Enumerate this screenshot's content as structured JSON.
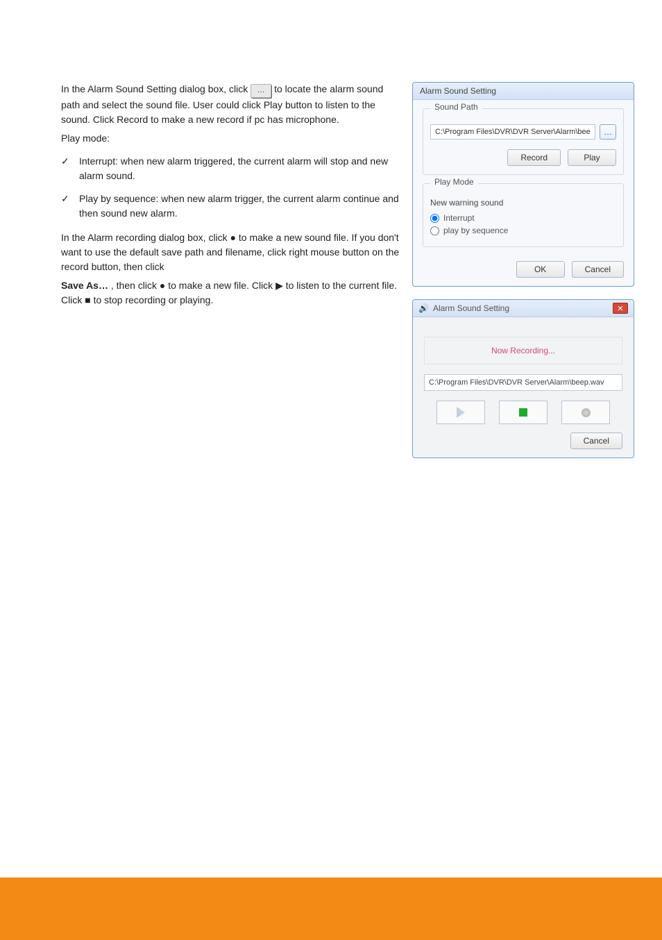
{
  "body": {
    "intro_p1": "In the Alarm Sound Setting dialog box, click  ",
    "intro_after_btn": " to locate the alarm sound path and select the sound file. User could click Play button to listen to the sound. Click Record to make a new record if pc has microphone.",
    "mode_label": "Play mode:",
    "radio_interrupt": "Interrupt: when new alarm triggered, the current alarm will stop and new alarm sound.",
    "radio_sequence": "Play by sequence: when new alarm trigger, the current alarm continue and then sound new alarm.",
    "after_radios": "In the Alarm recording dialog box, click ● to make a new sound file. If you don't want to use the default save path and filename, click right mouse button on the record button, then click ",
    "save_as": "Save As…",
    "after_saveas": ", then click ● to make a new file. Click ▶ to listen to the current file. Click ■ to stop recording or playing."
  },
  "dlg1": {
    "title": "Alarm Sound Setting",
    "group_sound": "Sound Path",
    "path_value": "C:\\Program Files\\DVR\\DVR Server\\Alarm\\bee",
    "browse_ell": "…",
    "record": "Record",
    "play": "Play",
    "group_playmode": "Play Mode",
    "label_newwarn": "New warning sound",
    "radio_interrupt": "Interrupt",
    "radio_seq": "play by sequence",
    "ok": "OK",
    "cancel": "Cancel"
  },
  "dlg2": {
    "title": "Alarm Sound Setting",
    "close": "✕",
    "now": "Now Recording...",
    "path": "C:\\Program Files\\DVR\\DVR Server\\Alarm\\beep.wav",
    "cancel": "Cancel"
  }
}
